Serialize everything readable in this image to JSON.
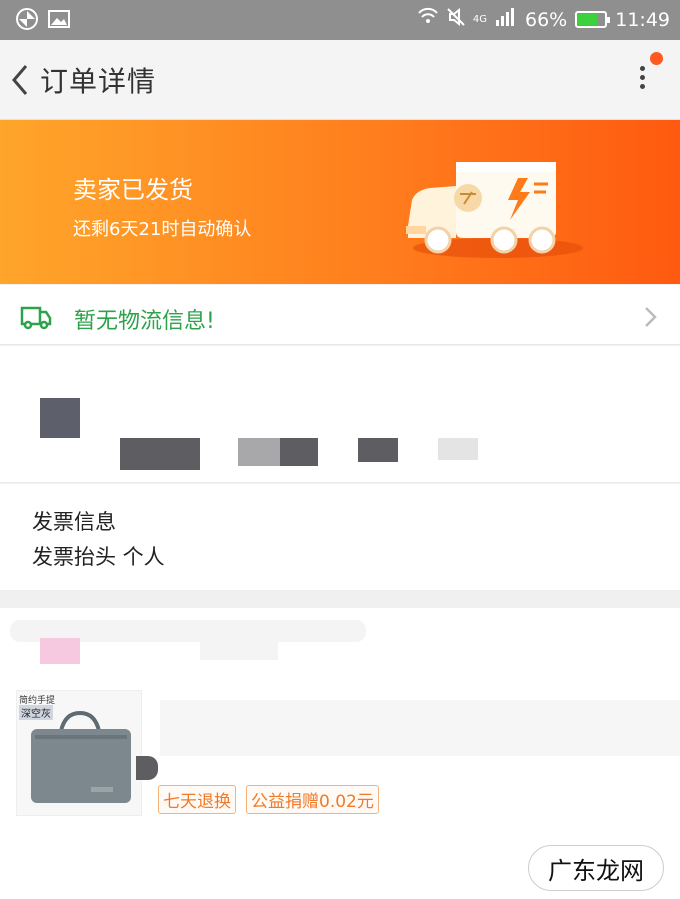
{
  "status_bar": {
    "network": "4G",
    "battery": "66%",
    "time": "11:49",
    "icons": [
      "gallery-icon",
      "wifi-icon",
      "mute-icon",
      "signal-icon",
      "battery-icon"
    ],
    "battery_color": "#3ed13e"
  },
  "nav": {
    "title": "订单详情",
    "back_icon": "chevron-left-icon",
    "more_icon": "more-vertical-icon",
    "badge_color": "#ff5a1f"
  },
  "banner": {
    "title": "卖家已发货",
    "subtitle": "还剩6天21时自动确认",
    "gradient": [
      "#ffa52a",
      "#ff5a10"
    ]
  },
  "logistics": {
    "text": "暂无物流信息!",
    "icon": "truck-icon",
    "color": "#2ea24a"
  },
  "invoice": {
    "title": "发票信息",
    "header": "发票抬头 个人"
  },
  "product": {
    "thumb_line1": "简约手提",
    "thumb_line2": "深空灰",
    "tags": [
      "七天退换",
      "公益捐赠0.02元"
    ],
    "tag_color": "#f07a28"
  },
  "watermark": {
    "text": "广东龙网"
  }
}
